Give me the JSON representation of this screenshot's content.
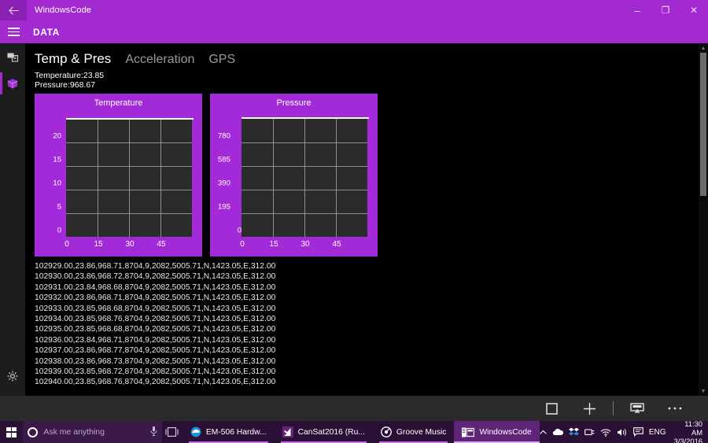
{
  "window": {
    "title": "WindowsCode",
    "back_icon": "back-arrow-icon",
    "minimize_label": "–",
    "maximize_label": "❐",
    "close_label": "✕"
  },
  "app_header": {
    "menu_icon": "hamburger-menu-icon",
    "title": "DATA"
  },
  "rail": {
    "items": [
      {
        "name": "connect-device-icon",
        "selected": false
      },
      {
        "name": "data-package-icon",
        "selected": true
      }
    ],
    "settings_icon": "gear-icon"
  },
  "tabs": [
    {
      "label": "Temp & Pres",
      "active": true
    },
    {
      "label": "Acceleration",
      "active": false
    },
    {
      "label": "GPS",
      "active": false
    }
  ],
  "readouts": {
    "temperature": "Temperature:23.85",
    "pressure": "Pressure:968.67"
  },
  "chart_data": [
    {
      "type": "line",
      "title": "Temperature",
      "xlabel": "",
      "ylabel": "",
      "x": [
        0,
        15,
        30,
        45,
        60
      ],
      "series": [
        {
          "name": "Temperature",
          "values": [
            23.85,
            23.85,
            23.85,
            23.85,
            23.85
          ]
        }
      ],
      "xticks": [
        "0",
        "15",
        "30",
        "45"
      ],
      "xtick_values": [
        0,
        15,
        30,
        45
      ],
      "yticks": [
        "0",
        "5",
        "10",
        "15",
        "20"
      ],
      "ytick_values": [
        0,
        5,
        10,
        15,
        20
      ],
      "xlim": [
        0,
        60
      ],
      "ylim": [
        0,
        24
      ],
      "grid": true,
      "line_color": "#ffffff",
      "plot_bg": "#2b2b2b",
      "card_bg": "#a32ad9"
    },
    {
      "type": "line",
      "title": "Pressure",
      "xlabel": "",
      "ylabel": "",
      "x": [
        0,
        15,
        30,
        45,
        60
      ],
      "series": [
        {
          "name": "Pressure",
          "values": [
            968.67,
            968.67,
            968.67,
            968.67,
            968.67
          ]
        }
      ],
      "xticks": [
        "0",
        "15",
        "30",
        "45"
      ],
      "xtick_values": [
        0,
        15,
        30,
        45
      ],
      "yticks": [
        "0",
        "195",
        "390",
        "585",
        "780"
      ],
      "ytick_values": [
        0,
        195,
        390,
        585,
        780
      ],
      "xlim": [
        0,
        60
      ],
      "ylim": [
        0,
        975
      ],
      "grid": true,
      "line_color": "#ffffff",
      "plot_bg": "#2b2b2b",
      "card_bg": "#a32ad9"
    }
  ],
  "log": {
    "lines": [
      "102929.00,23.86,968.71,8704,9,2082,5005.71,N,1423.05,E,312.00",
      "102930.00,23.86,968.72,8704,9,2082,5005.71,N,1423.05,E,312.00",
      "102931.00,23.84,968.68,8704,9,2082,5005.71,N,1423.05,E,312.00",
      "102932.00,23.86,968.71,8704,9,2082,5005.71,N,1423.05,E,312.00",
      "102933.00,23.85,968.68,8704,9,2082,5005.71,N,1423.05,E,312.00",
      "102934.00,23.85,968.76,8704,9,2082,5005.71,N,1423.05,E,312.00",
      "102935.00,23.85,968.68,8704,9,2082,5005.71,N,1423.05,E,312.00",
      "102936.00,23.84,968.71,8704,9,2082,5005.71,N,1423.05,E,312.00",
      "102937.00,23.86,968.77,8704,9,2082,5005.71,N,1423.05,E,312.00",
      "102938.00,23.86,968.73,8704,9,2082,5005.71,N,1423.05,E,312.00",
      "102939.00,23.85,968.72,8704,9,2082,5005.71,N,1423.05,E,312.00",
      "102940.00,23.85,968.76,8704,9,2082,5005.71,N,1423.05,E,312.00"
    ]
  },
  "appbar": {
    "stop_icon": "stop-square-icon",
    "add_icon": "plus-icon",
    "dock_icon": "pin-window-icon",
    "more_icon": "ellipsis-icon"
  },
  "scrollbar": {
    "up_icon": "chevron-up-icon",
    "down_icon": "chevron-down-icon"
  },
  "taskbar": {
    "start_icon": "windows-start-icon",
    "search_placeholder": "Ask me anything",
    "cortana_icon": "cortana-circle-icon",
    "mic_icon": "microphone-icon",
    "taskview_icon": "task-view-icon",
    "apps": [
      {
        "label": "EM-506 Hardw...",
        "icon": "edge-icon",
        "active": false
      },
      {
        "label": "CanSat2016 (Ru...",
        "icon": "visual-studio-icon",
        "active": false
      },
      {
        "label": "Groove Music",
        "icon": "groove-music-icon",
        "active": false
      },
      {
        "label": "WindowsCode",
        "icon": "windowscode-icon",
        "active": true
      }
    ],
    "tray": {
      "expand_icon": "chevron-up-icon",
      "icons": [
        "onedrive-icon",
        "dropbox-icon",
        "bluetooth-icon",
        "wifi-icon",
        "volume-icon",
        "action-center-icon"
      ],
      "language": "ENG",
      "time": "11:30 AM",
      "date": "3/3/2016"
    }
  },
  "colors": {
    "accent_purple": "#a22ad0",
    "card_purple": "#a32ad9",
    "taskbar_purple": "#2a1036",
    "plot_bg": "#2b2b2b"
  }
}
